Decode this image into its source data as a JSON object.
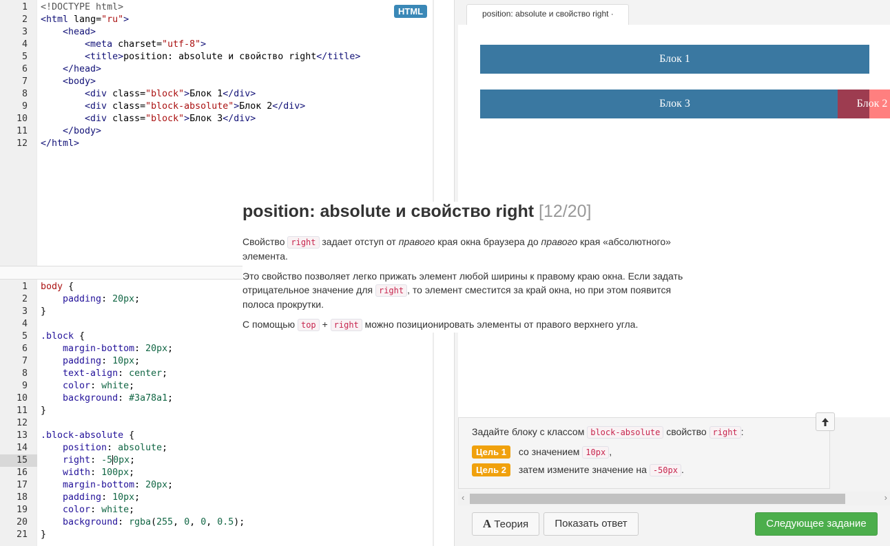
{
  "html_editor": {
    "badge": "HTML",
    "lines": [
      {
        "n": "1",
        "parts": [
          [
            "k-doc",
            "<!DOCTYPE html>"
          ]
        ]
      },
      {
        "n": "2",
        "parts": [
          [
            "k-tag",
            "<html "
          ],
          [
            "k-attr",
            "lang="
          ],
          [
            "k-str",
            "\"ru\""
          ],
          [
            "k-tag",
            ">"
          ]
        ]
      },
      {
        "n": "3",
        "parts": [
          [
            "k-tag",
            "    <head>"
          ]
        ]
      },
      {
        "n": "4",
        "parts": [
          [
            "k-tag",
            "        <meta "
          ],
          [
            "k-attr",
            "charset="
          ],
          [
            "k-str",
            "\"utf-8\""
          ],
          [
            "k-tag",
            ">"
          ]
        ]
      },
      {
        "n": "5",
        "parts": [
          [
            "k-tag",
            "        <title>"
          ],
          [
            "k-attr",
            "position: absolute и свойство right"
          ],
          [
            "k-tag",
            "</title>"
          ]
        ]
      },
      {
        "n": "6",
        "parts": [
          [
            "k-tag",
            "    </head>"
          ]
        ]
      },
      {
        "n": "7",
        "parts": [
          [
            "k-tag",
            "    <body>"
          ]
        ]
      },
      {
        "n": "8",
        "parts": [
          [
            "k-tag",
            "        <div "
          ],
          [
            "k-attr",
            "class="
          ],
          [
            "k-str",
            "\"block\""
          ],
          [
            "k-tag",
            ">"
          ],
          [
            "k-attr",
            "Блок 1"
          ],
          [
            "k-tag",
            "</div>"
          ]
        ]
      },
      {
        "n": "9",
        "parts": [
          [
            "k-tag",
            "        <div "
          ],
          [
            "k-attr",
            "class="
          ],
          [
            "k-str",
            "\"block-absolute\""
          ],
          [
            "k-tag",
            ">"
          ],
          [
            "k-attr",
            "Блок 2"
          ],
          [
            "k-tag",
            "</div>"
          ]
        ]
      },
      {
        "n": "10",
        "parts": [
          [
            "k-tag",
            "        <div "
          ],
          [
            "k-attr",
            "class="
          ],
          [
            "k-str",
            "\"block\""
          ],
          [
            "k-tag",
            ">"
          ],
          [
            "k-attr",
            "Блок 3"
          ],
          [
            "k-tag",
            "</div>"
          ]
        ]
      },
      {
        "n": "11",
        "parts": [
          [
            "k-tag",
            "    </body>"
          ]
        ]
      },
      {
        "n": "12",
        "parts": [
          [
            "k-tag",
            "</html>"
          ]
        ]
      }
    ]
  },
  "css_editor": {
    "active_line": "15",
    "lines": [
      {
        "n": "1",
        "parts": [
          [
            "c-sel",
            "body"
          ],
          [
            "c-brace",
            " {"
          ]
        ]
      },
      {
        "n": "2",
        "parts": [
          [
            "c-prop",
            "    padding"
          ],
          [
            "c-brace",
            ": "
          ],
          [
            "c-num",
            "20px"
          ],
          [
            "c-brace",
            ";"
          ]
        ]
      },
      {
        "n": "3",
        "parts": [
          [
            "c-brace",
            "}"
          ]
        ]
      },
      {
        "n": "4",
        "parts": []
      },
      {
        "n": "5",
        "parts": [
          [
            "c-prop",
            ".block"
          ],
          [
            "c-brace",
            " {"
          ]
        ]
      },
      {
        "n": "6",
        "parts": [
          [
            "c-prop",
            "    margin-bottom"
          ],
          [
            "c-brace",
            ": "
          ],
          [
            "c-num",
            "20px"
          ],
          [
            "c-brace",
            ";"
          ]
        ]
      },
      {
        "n": "7",
        "parts": [
          [
            "c-prop",
            "    padding"
          ],
          [
            "c-brace",
            ": "
          ],
          [
            "c-num",
            "10px"
          ],
          [
            "c-brace",
            ";"
          ]
        ]
      },
      {
        "n": "8",
        "parts": [
          [
            "c-prop",
            "    text-align"
          ],
          [
            "c-brace",
            ": "
          ],
          [
            "c-val",
            "center"
          ],
          [
            "c-brace",
            ";"
          ]
        ]
      },
      {
        "n": "9",
        "parts": [
          [
            "c-prop",
            "    color"
          ],
          [
            "c-brace",
            ": "
          ],
          [
            "c-val",
            "white"
          ],
          [
            "c-brace",
            ";"
          ]
        ]
      },
      {
        "n": "10",
        "parts": [
          [
            "c-prop",
            "    background"
          ],
          [
            "c-brace",
            ": "
          ],
          [
            "c-num",
            "#3a78a1"
          ],
          [
            "c-brace",
            ";"
          ]
        ]
      },
      {
        "n": "11",
        "parts": [
          [
            "c-brace",
            "}"
          ]
        ]
      },
      {
        "n": "12",
        "parts": []
      },
      {
        "n": "13",
        "parts": [
          [
            "c-prop",
            ".block-absolute"
          ],
          [
            "c-brace",
            " {"
          ]
        ]
      },
      {
        "n": "14",
        "parts": [
          [
            "c-prop",
            "    position"
          ],
          [
            "c-brace",
            ": "
          ],
          [
            "c-val",
            "absolute"
          ],
          [
            "c-brace",
            ";"
          ]
        ]
      },
      {
        "n": "15",
        "parts": [
          [
            "c-prop",
            "    right"
          ],
          [
            "c-brace",
            ": "
          ],
          [
            "c-num",
            "-5"
          ],
          [
            "cursor",
            ""
          ],
          [
            "c-num",
            "0px"
          ],
          [
            "c-brace",
            ";"
          ]
        ]
      },
      {
        "n": "16",
        "parts": [
          [
            "c-prop",
            "    width"
          ],
          [
            "c-brace",
            ": "
          ],
          [
            "c-num",
            "100px"
          ],
          [
            "c-brace",
            ";"
          ]
        ]
      },
      {
        "n": "17",
        "parts": [
          [
            "c-prop",
            "    margin-bottom"
          ],
          [
            "c-brace",
            ": "
          ],
          [
            "c-num",
            "20px"
          ],
          [
            "c-brace",
            ";"
          ]
        ]
      },
      {
        "n": "18",
        "parts": [
          [
            "c-prop",
            "    padding"
          ],
          [
            "c-brace",
            ": "
          ],
          [
            "c-num",
            "10px"
          ],
          [
            "c-brace",
            ";"
          ]
        ]
      },
      {
        "n": "19",
        "parts": [
          [
            "c-prop",
            "    color"
          ],
          [
            "c-brace",
            ": "
          ],
          [
            "c-val",
            "white"
          ],
          [
            "c-brace",
            ";"
          ]
        ]
      },
      {
        "n": "20",
        "parts": [
          [
            "c-prop",
            "    background"
          ],
          [
            "c-brace",
            ": "
          ],
          [
            "c-val",
            "rgba"
          ],
          [
            "c-brace",
            "("
          ],
          [
            "c-num",
            "255"
          ],
          [
            "c-brace",
            ", "
          ],
          [
            "c-num",
            "0"
          ],
          [
            "c-brace",
            ", "
          ],
          [
            "c-num",
            "0"
          ],
          [
            "c-brace",
            ", "
          ],
          [
            "c-num",
            "0.5"
          ],
          [
            "c-brace",
            ");"
          ]
        ]
      },
      {
        "n": "21",
        "parts": [
          [
            "c-brace",
            "}"
          ]
        ]
      }
    ]
  },
  "preview": {
    "tab_title": "position: absolute и свойство right ·",
    "block1": "Блок 1",
    "block2": "Блок 2",
    "block3": "Блок 3",
    "colors": {
      "block": "#3a78a1",
      "block_absolute": "rgba(255,0,0,0.5)"
    }
  },
  "theory": {
    "title": "position: absolute и свойство right",
    "counter": "[12/20]",
    "p1_a": "Свойство",
    "p1_code": "right",
    "p1_b": "задает отступ от",
    "p1_em1": "правого",
    "p1_c": "края окна браузера до",
    "p1_em2": "правого",
    "p1_d": "края «абсолютного»",
    "p1_e": "элемента.",
    "p2_a": "Это свойство позволяет легко прижать элемент любой ширины к правому краю окна. Если задать",
    "p2_b": "отрицательное значение для",
    "p2_code": "right",
    "p2_c": ", то элемент сместится за край окна, но при этом появится",
    "p2_d": "полоса прокрутки.",
    "p3_a": "С помощью",
    "p3_code1": "top",
    "p3_plus": "+",
    "p3_code2": "right",
    "p3_b": "можно позиционировать элементы от правого верхнего угла."
  },
  "task": {
    "intro_a": "Задайте блоку с классом",
    "intro_code1": "block-absolute",
    "intro_b": "свойство",
    "intro_code2": "right",
    "intro_c": ":",
    "goal1_label": "Цель 1",
    "goal1_a": "со значением",
    "goal1_code": "10px",
    "goal1_b": ",",
    "goal2_label": "Цель 2",
    "goal2_a": "затем измените значение на",
    "goal2_code": "-50px",
    "goal2_b": ".",
    "up_icon": "arrow-up-icon"
  },
  "buttons": {
    "theory": "Теория",
    "theory_icon": "A",
    "show_answer": "Показать ответ",
    "next": "Следующее задание"
  }
}
